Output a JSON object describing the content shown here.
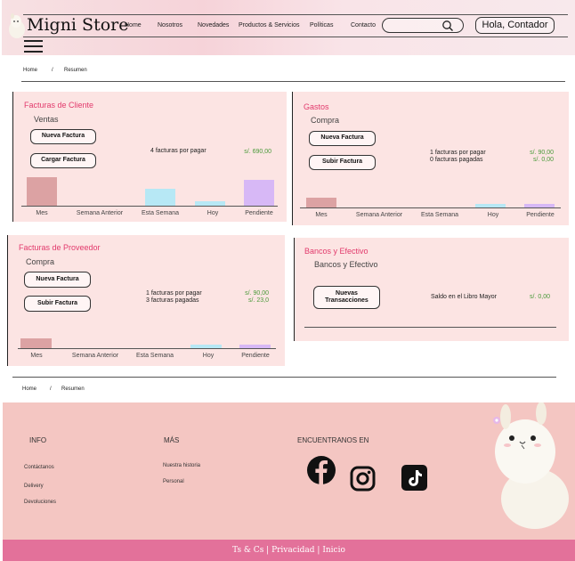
{
  "header": {
    "brand": "Migni Store",
    "nav": [
      "Home",
      "Nosotros",
      "Novedades",
      "Productos & Servicios",
      "Políticas",
      "Contacto"
    ],
    "search_placeholder": "",
    "greeting": "Hola, Contador"
  },
  "breadcrumb": {
    "home": "Home",
    "separator": "/",
    "current": "Resumen"
  },
  "cards": {
    "facturas_cliente": {
      "title": "Facturas de Cliente",
      "subtitle": "Ventas",
      "buttons": [
        "Nueva Factura",
        "Cargar Factura"
      ],
      "status_lines": [
        "4 facturas por pagar"
      ],
      "amounts": [
        "s/. 690,00"
      ],
      "bar_labels": [
        "Mes",
        "Semana Anterior",
        "Esta Semana",
        "Hoy",
        "Pendiente"
      ],
      "bar_levels": [
        0.95,
        0,
        0.57,
        0.14,
        0.86
      ]
    },
    "gastos": {
      "title": "Gastos",
      "subtitle": "Compra",
      "buttons": [
        "Nueva Factura",
        "Subir Factura"
      ],
      "status_lines": [
        "1 facturas por pagar",
        "0 facturas pagadas"
      ],
      "amounts": [
        "s/. 90,00",
        "s/. 0,00"
      ],
      "bar_labels": [
        "Mes",
        "Semana Anterior",
        "Esta Semana",
        "Hoy",
        "Pendiente"
      ],
      "bar_levels": [
        0.95,
        0,
        0,
        0.3,
        0.3
      ]
    },
    "facturas_proveedor": {
      "title": "Facturas de Proveedor",
      "subtitle": "Compra",
      "buttons": [
        "Nueva Factura",
        "Subir Factura"
      ],
      "status_lines": [
        "1 facturas por pagar",
        "3 facturas pagadas"
      ],
      "amounts": [
        "s/. 90,00",
        "s/. 23,0"
      ],
      "bar_labels": [
        "Mes",
        "Semana Anterior",
        "Esta Semana",
        "Hoy",
        "Pendiente"
      ],
      "bar_levels": [
        0.95,
        0,
        0,
        0.35,
        0.35
      ]
    },
    "bancos": {
      "title": "Bancos y Efectivo",
      "subtitle": "Bancos y Efectivo",
      "button": "Nuevas Transacciones",
      "status": "Saldo en el Libro Mayor",
      "amount": "s/. 0,00"
    }
  },
  "bar_colors": [
    "#dca2a3",
    "#c9c9c9",
    "#b7e8f5",
    "#b7e8f5",
    "#d7b8f6"
  ],
  "footer": {
    "info_title": "INFO",
    "info_links": [
      "Contáctanos",
      "Delivery",
      "Devoluciones"
    ],
    "mas_title": "MÁS",
    "mas_links": [
      "Nuestra historia",
      "Personal"
    ],
    "social_title": "ENCUENTRANOS EN",
    "social_icons": [
      "facebook-icon",
      "instagram-icon",
      "tiktok-icon"
    ],
    "bottom": "Ts & Cs |  Privacidad  | Inicio"
  },
  "colors": {
    "accent": "#e23a6c",
    "amount_green": "#4a9a3a",
    "card_bg": "#fce4e3",
    "footer_bg": "#f4c6c2",
    "bottom_bar": "#e3719a"
  }
}
